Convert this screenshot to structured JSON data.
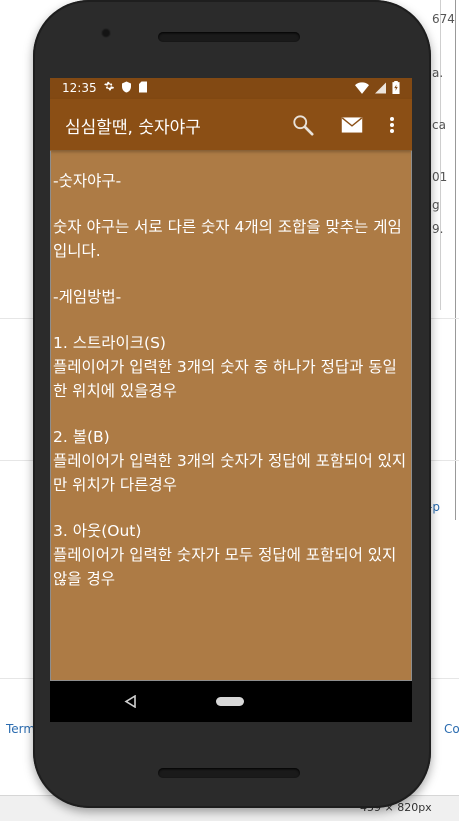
{
  "background": {
    "right_fragments": [
      "674",
      "a.",
      "ca",
      "01",
      "g",
      "9.",
      "-p"
    ],
    "bottom_left_link": "Term",
    "bottom_right_link": "Co",
    "status_size": "459 × 820px"
  },
  "statusbar": {
    "time": "12:35"
  },
  "appbar": {
    "title": "심심할땐, 숫자야구",
    "search_label": "search",
    "mail_label": "mail",
    "more_label": "more options"
  },
  "content": {
    "heading": "-숫자야구-",
    "intro": "숫자 야구는 서로 다른 숫자 4개의 조합을 맞추는 게임입니다.",
    "rules_heading": "-게임방법-",
    "rule1_title": "1. 스트라이크(S)",
    "rule1_text": "플레이어가 입력한 3개의 숫자 중 하나가 정답과 동일한 위치에 있을경우",
    "rule2_title": "2. 볼(B)",
    "rule2_text": "플레이어가 입력한 3개의 숫자가 정답에 포함되어 있지만 위치가 다른경우",
    "rule3_title": "3. 아웃(Out)",
    "rule3_text": "플레이어가 입력한 숫자가 모두 정답에 포함되어 있지 않을 경우"
  },
  "colors": {
    "statusbar": "#824913",
    "appbar": "#8b4f15",
    "content_bg": "#ad7b45",
    "text": "#ffffff"
  }
}
